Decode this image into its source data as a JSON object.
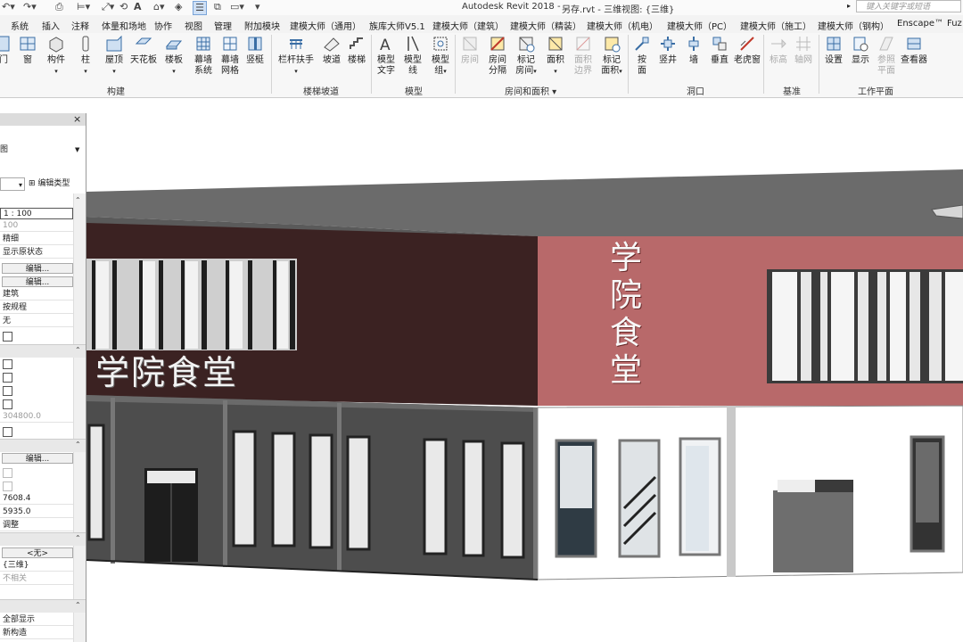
{
  "app": {
    "title": "Autodesk Revit 2018 -",
    "file": "另存.rvt - 三维视图: {三维}",
    "search_placeholder": "键入关键字或短语"
  },
  "menu": [
    "系统",
    "插入",
    "注释",
    "体量和场地",
    "协作",
    "视图",
    "管理",
    "附加模块",
    "建模大师（通用）",
    "族库大师V5.1",
    "建模大师（建筑）",
    "建模大师（精装）",
    "建模大师（机电）",
    "建模大师（PC）",
    "建模大师（施工）",
    "建模大师（钢构）",
    "Enscape™",
    "Fuz"
  ],
  "ribbon": {
    "tools": {
      "door": "门",
      "window": "窗",
      "component": "构件",
      "column": "柱",
      "roof": "屋顶",
      "ceiling": "天花板",
      "floor": "楼板",
      "curtain_system_1": "幕墙",
      "curtain_system_2": "系统",
      "curtain_grid_1": "幕墙",
      "curtain_grid_2": "网格",
      "mullion": "竖梃",
      "railing": "栏杆扶手",
      "ramp": "坡道",
      "stair": "楼梯",
      "model_text_1": "模型",
      "model_text_2": "文字",
      "model_line_1": "模型",
      "model_line_2": "线",
      "model_group_1": "模型",
      "model_group_2": "组",
      "room": "房间",
      "room_sep_1": "房间",
      "room_sep_2": "分隔",
      "tag_room_1": "标记",
      "tag_room_2": "房间",
      "area": "面积",
      "area_boundary_1": "面积",
      "area_boundary_2": "边界",
      "tag_area_1": "标记",
      "tag_area_2": "面积",
      "by_face_1": "按",
      "by_face_2": "面",
      "shaft": "竖井",
      "wall": "墙",
      "vertical": "垂直",
      "dormer": "老虎窗",
      "level": "标高",
      "grid": "轴网",
      "set": "设置",
      "show": "显示",
      "ref_plane_1": "参照",
      "ref_plane_2": "平面",
      "viewer": "查看器"
    },
    "groups": {
      "build": "构建",
      "circulation": "楼梯坡道",
      "model": "模型",
      "room_area": "房间和面积 ▾",
      "opening": "洞口",
      "datum": "基准",
      "work_plane": "工作平面"
    }
  },
  "properties": {
    "view_type": "图",
    "edit_type": "编辑类型",
    "scale": "1 : 100",
    "scale_value": "100",
    "detail_level": "精细",
    "parts_visibility": "显示原状态",
    "edit1": "编辑...",
    "edit2": "编辑...",
    "discipline": "建筑",
    "show_hidden": "按规程",
    "default_analysis": "无",
    "eye_elev": "304800.0",
    "edit3": "编辑...",
    "camera1": "7608.4",
    "camera2": "5935.0",
    "adjust": "调整",
    "none_btn": "<无>",
    "view_name": "{三维}",
    "dependency": "不相关",
    "show_all": "全部显示",
    "new_construction": "新构造"
  },
  "building": {
    "sign_horizontal": "学院食堂",
    "sign_vertical": [
      "学",
      "院",
      "食",
      "堂"
    ]
  },
  "colors": {
    "maroon": "#3b2222",
    "rose": "#b8696a",
    "dark_grey_wall": "#505050",
    "roof": "#6b6b6b"
  }
}
